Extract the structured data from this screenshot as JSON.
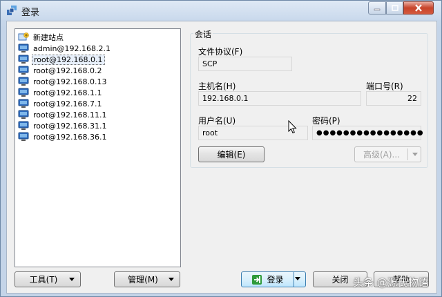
{
  "window": {
    "title": "登录"
  },
  "sites": [
    {
      "label": "新建站点",
      "icon": "new-site-icon"
    },
    {
      "label": "admin@192.168.2.1",
      "icon": "computer-icon"
    },
    {
      "label": "root@192.168.0.1",
      "icon": "computer-icon",
      "selected": true
    },
    {
      "label": "root@192.168.0.2",
      "icon": "computer-icon"
    },
    {
      "label": "root@192.168.0.13",
      "icon": "computer-icon"
    },
    {
      "label": "root@192.168.1.1",
      "icon": "computer-icon"
    },
    {
      "label": "root@192.168.7.1",
      "icon": "computer-icon"
    },
    {
      "label": "root@192.168.11.1",
      "icon": "computer-icon"
    },
    {
      "label": "root@192.168.31.1",
      "icon": "computer-icon"
    },
    {
      "label": "root@192.168.36.1",
      "icon": "computer-icon"
    }
  ],
  "bottom": {
    "tools_label": "工具(T)",
    "manage_label": "管理(M)"
  },
  "session": {
    "group_title": "会话",
    "protocol_label": "文件协议(F)",
    "protocol_value": "SCP",
    "host_label": "主机名(H)",
    "host_value": "192.168.0.1",
    "port_label": "端口号(R)",
    "port_value": "22",
    "user_label": "用户名(U)",
    "user_value": "root",
    "password_label": "密码(P)",
    "password_value": "●●●●●●●●●●●●●●●●",
    "edit_label": "编辑(E)",
    "advanced_label": "高级(A)..."
  },
  "actions": {
    "login_label": "登录",
    "close_label": "关闭",
    "help_label": "帮助"
  },
  "watermark": "头条 @源氏物语",
  "colors": {
    "accent": "#3c7fb1",
    "login_icon": "#2e9a3a"
  }
}
